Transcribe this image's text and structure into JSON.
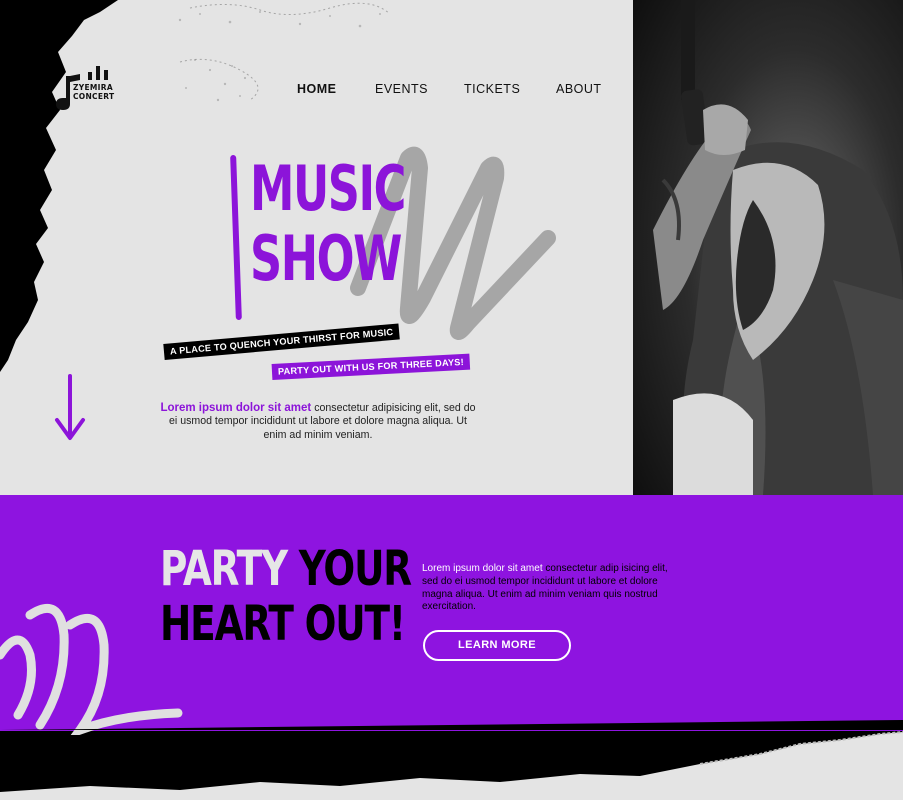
{
  "brand": {
    "name_line1": "ZYEMIRA",
    "name_line2": "CONCERT",
    "logo_icon": "music-note-equalizer-icon",
    "accent_color": "#8c14d9"
  },
  "nav": {
    "items": [
      {
        "label": "HOME",
        "active": true
      },
      {
        "label": "EVENTS",
        "active": false
      },
      {
        "label": "TICKETS",
        "active": false
      },
      {
        "label": "ABOUT",
        "active": false
      }
    ]
  },
  "hero": {
    "title_line1": "MUSIC",
    "title_line2": "SHOW",
    "tagline1": "A PLACE TO QUENCH YOUR THIRST FOR MUSIC",
    "tagline2": "PARTY OUT WITH US FOR THREE DAYS!",
    "para_lead": "Lorem ipsum dolor sit amet",
    "para_rest": " consectetur adipisicing elit, sed do ei usmod tempor incididunt ut labore et dolore magna aliqua. Ut enim ad minim veniam.",
    "scroll_icon": "arrow-down-icon"
  },
  "feature": {
    "title_word1": "PARTY",
    "title_word2": "YOUR",
    "title_line2": "HEART OUT!",
    "para_lead": "Lorem ipsum dolor sit amet",
    "para_rest": " consectetur adip isicing elit, sed do ei usmod tempor incididunt ut labore et dolore magna aliqua. Ut enim ad minim veniam quis nostrud exercitation.",
    "button_label": "LEARN MORE"
  }
}
